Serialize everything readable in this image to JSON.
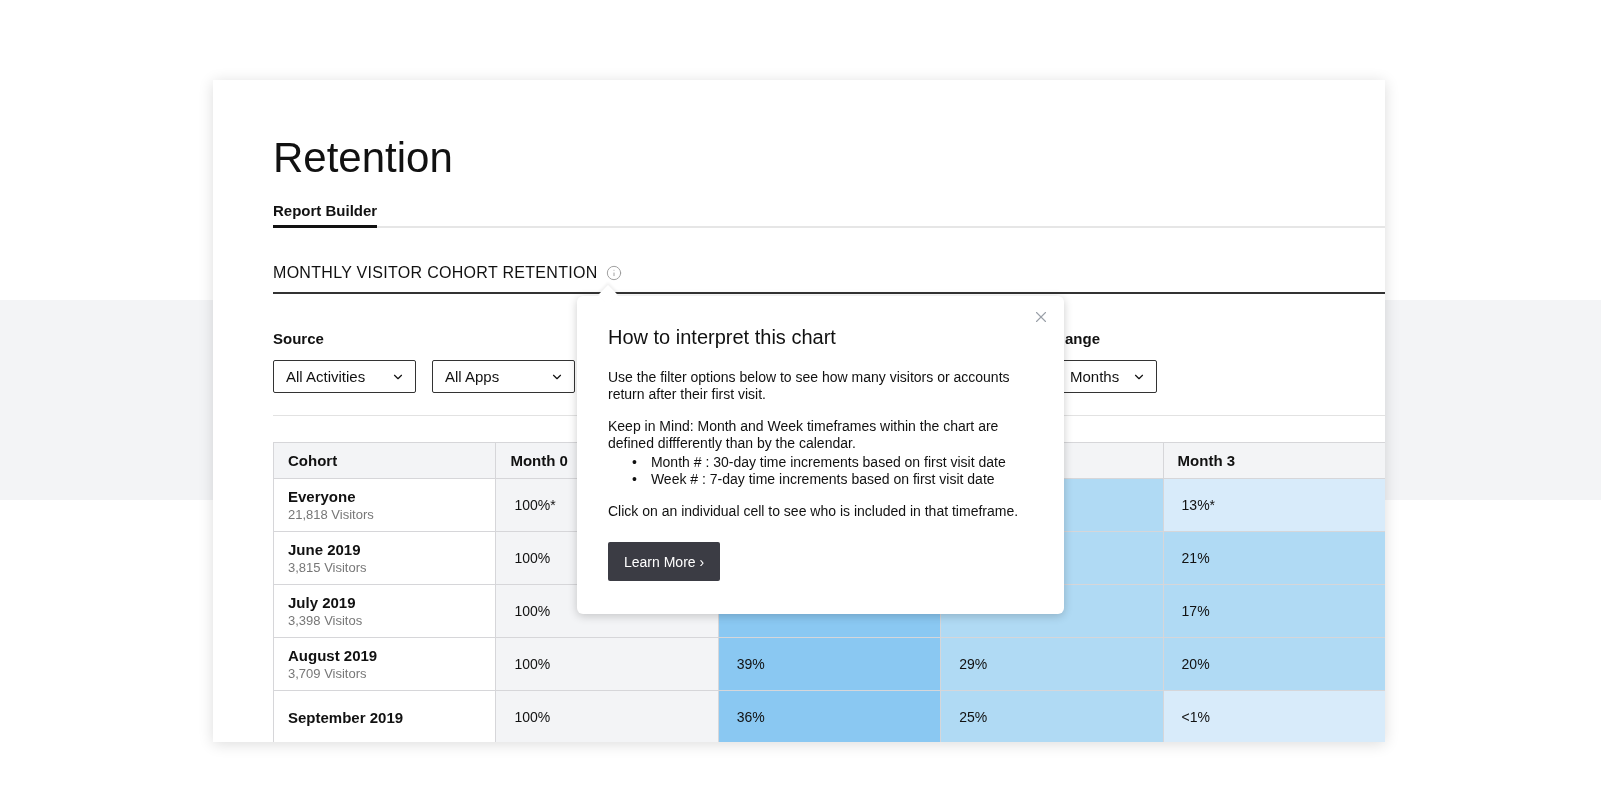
{
  "page": {
    "title": "Retention"
  },
  "tabs": [
    {
      "label": "Report Builder",
      "selected": true
    }
  ],
  "section": {
    "title": "MONTHLY VISITOR COHORT RETENTION"
  },
  "filters": {
    "source": {
      "label": "Source",
      "dropdowns": [
        "All Activities",
        "All Apps"
      ]
    },
    "range": {
      "label": "ange",
      "dropdown": "Months"
    }
  },
  "table": {
    "columns": [
      "Cohort",
      "Month 0",
      "",
      "",
      "Month 3"
    ],
    "rows": [
      {
        "cells": [
          {
            "name": "Everyone",
            "visitors": "21,818 Visitors"
          },
          {
            "text": "100%*",
            "color": "#f3f4f6"
          },
          "",
          {
            "color": "#b0daf4"
          },
          {
            "text": "13%*",
            "color": "#d8ebfa"
          }
        ]
      },
      {
        "cells": [
          {
            "name": "June 2019",
            "visitors": "3,815 Visitors"
          },
          {
            "text": "100%",
            "color": "#f3f4f6"
          },
          "",
          {
            "color": "#b0daf4"
          },
          {
            "text": "21%",
            "color": "#b0daf4"
          }
        ]
      },
      {
        "cells": [
          {
            "name": "July 2019",
            "visitors": "3,398 Visitos"
          },
          {
            "text": "100%",
            "color": "#f3f4f6"
          },
          {
            "color": "#8ac8f2"
          },
          {
            "color": "#b0daf4"
          },
          {
            "text": "17%",
            "color": "#b0daf4"
          }
        ]
      },
      {
        "cells": [
          {
            "name": "August 2019",
            "visitors": "3,709 Visitors"
          },
          {
            "text": "100%",
            "color": "#f3f4f6"
          },
          {
            "text": "39%",
            "color": "#8ac8f2"
          },
          {
            "text": "29%",
            "color": "#b0daf4"
          },
          {
            "text": "20%",
            "color": "#b0daf4"
          }
        ]
      },
      {
        "cells": [
          {
            "name": "September 2019"
          },
          {
            "text": "100%",
            "color": "#f3f4f6"
          },
          {
            "text": "36%",
            "color": "#8ac8f2"
          },
          {
            "text": "25%",
            "color": "#b0daf4"
          },
          {
            "text": "<1%",
            "color": "#d8ebfa"
          }
        ]
      }
    ]
  },
  "popover": {
    "title": "How to interpret this chart",
    "intro": "Use the filter options below to see how many visitors or accounts return after their first visit.",
    "note": "Keep in Mind: Month and Week timeframes within the chart are defined diffferently than by the calendar.",
    "bullets": [
      {
        "marker": "•",
        "text": "Month # : 30-day time increments based on first visit date"
      },
      {
        "marker": "•",
        "text": "Week # : 7-day time increments based on first visit date"
      }
    ],
    "closing": "Click on an individual cell to see who is included in that timeframe.",
    "button": "Learn More ›"
  }
}
